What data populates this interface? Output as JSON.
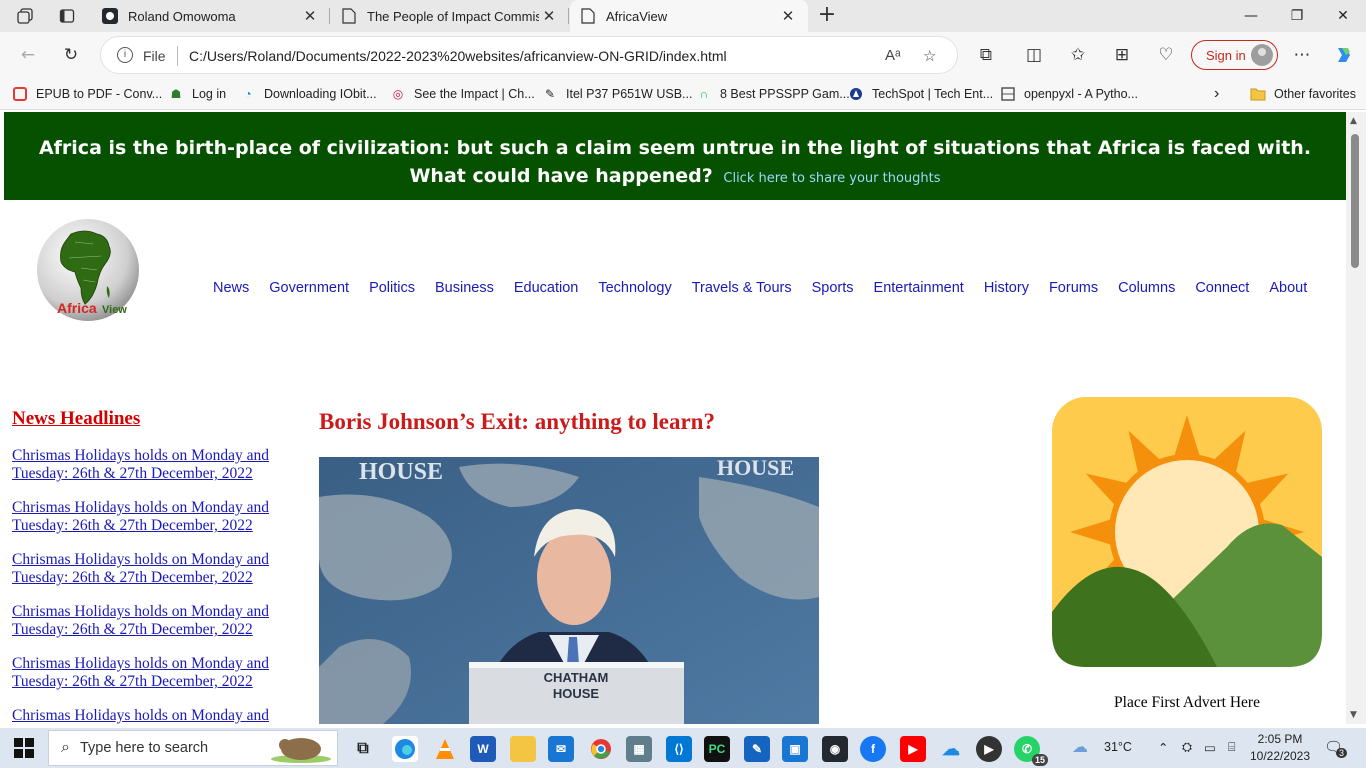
{
  "browser": {
    "tabs": [
      {
        "title": "Roland Omowoma",
        "active": false
      },
      {
        "title": "The People of Impact Commissio",
        "active": false
      },
      {
        "title": "AfricaView",
        "active": true
      }
    ],
    "address": {
      "scheme_label": "File",
      "url": "C:/Users/Roland/Documents/2022-2023%20websites/africanview-ON-GRID/index.html"
    },
    "sign_in": "Sign in",
    "favorites": [
      {
        "label": "EPUB to PDF - Conv..."
      },
      {
        "label": "Log in"
      },
      {
        "label": "Downloading IObit..."
      },
      {
        "label": "See the Impact | Ch..."
      },
      {
        "label": "Itel P37 P651W USB..."
      },
      {
        "label": "8 Best PPSSPP Gam..."
      },
      {
        "label": "TechSpot | Tech Ent..."
      },
      {
        "label": "openpyxl - A Pytho..."
      }
    ],
    "other_favorites": "Other favorites"
  },
  "page": {
    "banner": {
      "line1": "Africa is the birth-place of civilization: but such a claim seem untrue in the light of situations that Africa is faced with.",
      "line2": "What could have happened?",
      "link": "Click here to share your thoughts"
    },
    "logo_text": "AfricaView",
    "nav": [
      "News",
      "Government",
      "Politics",
      "Business",
      "Education",
      "Technology",
      "Travels & Tours",
      "Sports",
      "Entertainment",
      "History",
      "Forums",
      "Columns",
      "Connect",
      "About"
    ],
    "headlines": {
      "title": "News Headlines",
      "items": [
        "Chrismas Holidays holds on Monday and Tuesday: 26th & 27th December, 2022",
        "Chrismas Holidays holds on Monday and Tuesday: 26th & 27th December, 2022",
        "Chrismas Holidays holds on Monday and Tuesday: 26th & 27th December, 2022",
        "Chrismas Holidays holds on Monday and Tuesday: 26th & 27th December, 2022",
        "Chrismas Holidays holds on Monday and Tuesday: 26th & 27th December, 2022",
        "Chrismas Holidays holds on Monday and"
      ]
    },
    "article": {
      "title": "Boris Johnson’s Exit: anything to learn?",
      "image_text": {
        "wall_left": "HOUSE",
        "wall_right": "HOUSE",
        "podium_l1": "CHATHAM",
        "podium_l2": "HOUSE"
      }
    },
    "advert": {
      "text": "Place First Advert Here"
    }
  },
  "taskbar": {
    "search_placeholder": "Type here to search",
    "weather": "31°C",
    "time": "2:05 PM",
    "date": "10/22/2023",
    "whatsapp_badge": "15",
    "notification_badge": "3"
  },
  "colors": {
    "banner_bg": "#055100",
    "link": "#1a1ab8",
    "headline_red": "#d40000",
    "title_red": "#cc1a1a"
  }
}
